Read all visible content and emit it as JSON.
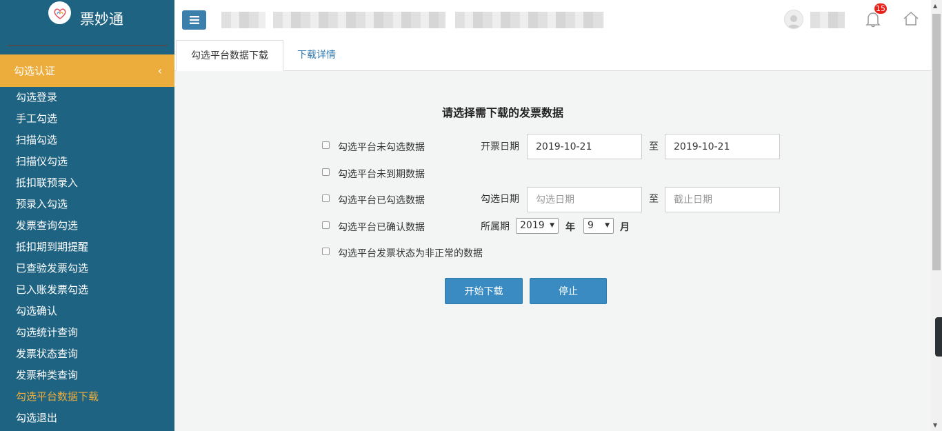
{
  "app": {
    "name": "票妙通"
  },
  "sidebar": {
    "section_label": "勾选认证",
    "section_chevron": "‹",
    "items": [
      {
        "label": "勾选登录"
      },
      {
        "label": "手工勾选"
      },
      {
        "label": "扫描勾选"
      },
      {
        "label": "扫描仪勾选"
      },
      {
        "label": "抵扣联预录入"
      },
      {
        "label": "预录入勾选"
      },
      {
        "label": "发票查询勾选"
      },
      {
        "label": "抵扣期到期提醒"
      },
      {
        "label": "已查验发票勾选"
      },
      {
        "label": "已入账发票勾选"
      },
      {
        "label": "勾选确认"
      },
      {
        "label": "勾选统计查询"
      },
      {
        "label": "发票状态查询"
      },
      {
        "label": "发票种类查询"
      },
      {
        "label": "勾选平台数据下载"
      },
      {
        "label": "勾选退出"
      }
    ],
    "active_item": "勾选平台数据下载"
  },
  "header": {
    "notification_count": "15"
  },
  "tabs": [
    {
      "label": "勾选平台数据下载"
    },
    {
      "label": "下载详情"
    }
  ],
  "form": {
    "title": "请选择需下载的发票数据",
    "options": [
      {
        "label": "勾选平台未勾选数据",
        "checked": false
      },
      {
        "label": "勾选平台未到期数据",
        "checked": false
      },
      {
        "label": "勾选平台已勾选数据",
        "checked": false
      },
      {
        "label": "勾选平台已确认数据",
        "checked": false
      },
      {
        "label": "勾选平台发票状态为非正常的数据",
        "checked": false
      }
    ],
    "invoice_date": {
      "label": "开票日期",
      "from": "2019-10-21",
      "separator": "至",
      "to": "2019-10-21"
    },
    "select_date": {
      "label": "勾选日期",
      "from_placeholder": "勾选日期",
      "separator": "至",
      "to_placeholder": "截止日期"
    },
    "period": {
      "label": "所属期",
      "year": "2019",
      "year_unit": "年",
      "month": "9",
      "month_unit": "月"
    },
    "buttons": {
      "start": "开始下载",
      "stop": "停止"
    }
  },
  "colors": {
    "sidebar_bg": "#1f6382",
    "accent": "#ecad3c",
    "primary_button": "#3a8bc1",
    "badge": "#e8231c"
  }
}
